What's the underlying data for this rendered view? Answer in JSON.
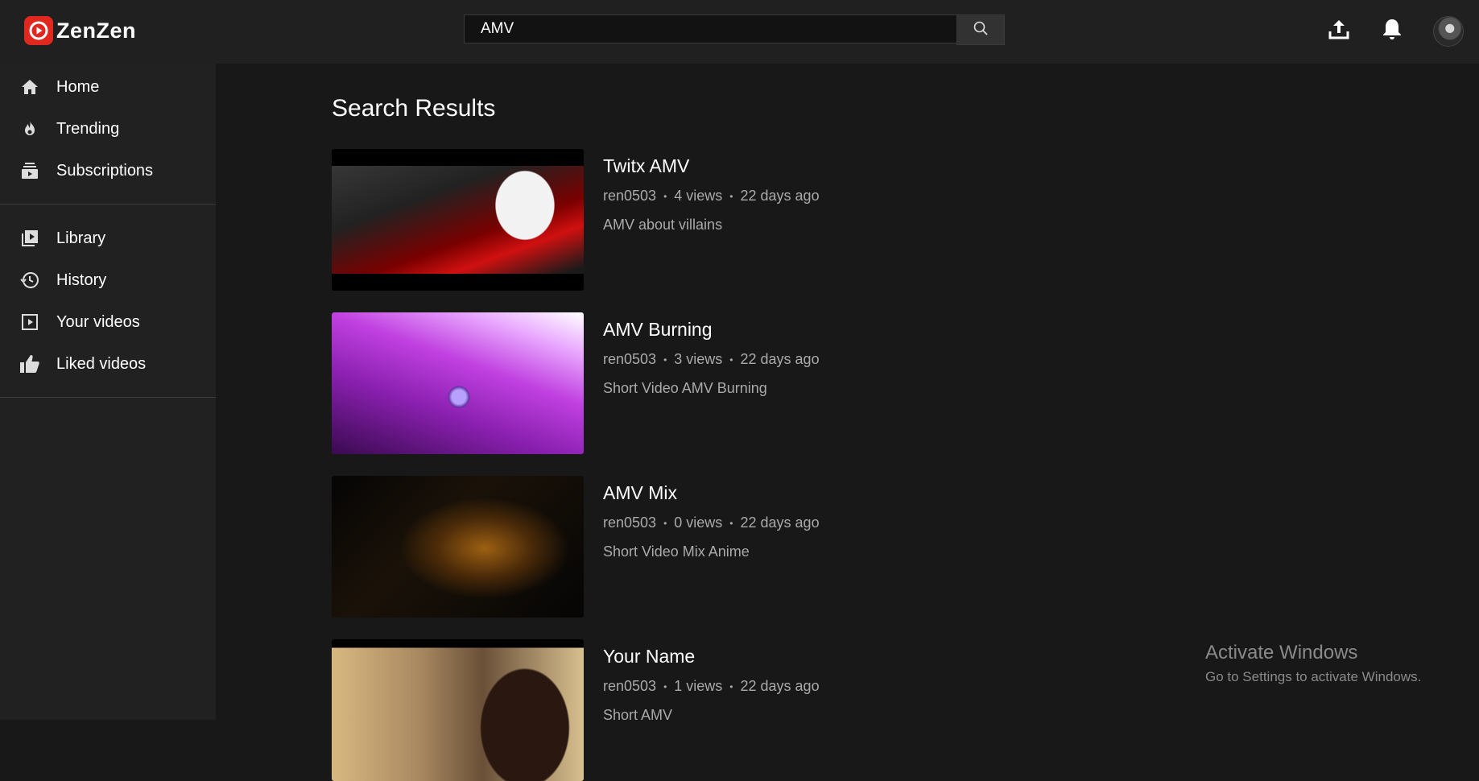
{
  "app": {
    "name": "ZenZen",
    "accent": "#e0281f"
  },
  "search": {
    "value": "AMV",
    "button_icon": "search-icon"
  },
  "header_icons": [
    "upload-icon",
    "bell-icon",
    "avatar"
  ],
  "sidebar": {
    "primary": [
      {
        "label": "Home",
        "icon": "home-icon"
      },
      {
        "label": "Trending",
        "icon": "flame-icon"
      },
      {
        "label": "Subscriptions",
        "icon": "subscriptions-icon"
      }
    ],
    "secondary": [
      {
        "label": "Library",
        "icon": "library-icon"
      },
      {
        "label": "History",
        "icon": "history-icon"
      },
      {
        "label": "Your videos",
        "icon": "your-videos-icon"
      },
      {
        "label": "Liked videos",
        "icon": "thumbs-up-icon"
      }
    ]
  },
  "main": {
    "title": "Search Results",
    "results": [
      {
        "title": "Twitx AMV",
        "channel": "ren0503",
        "views": "4 views",
        "age": "22 days ago",
        "description": "AMV about villains"
      },
      {
        "title": "AMV Burning",
        "channel": "ren0503",
        "views": "3 views",
        "age": "22 days ago",
        "description": "Short Video AMV Burning"
      },
      {
        "title": "AMV Mix",
        "channel": "ren0503",
        "views": "0 views",
        "age": "22 days ago",
        "description": "Short Video Mix Anime"
      },
      {
        "title": "Your Name",
        "channel": "ren0503",
        "views": "1 views",
        "age": "22 days ago",
        "description": "Short AMV"
      }
    ]
  },
  "watermark": {
    "line1": "Activate Windows",
    "line2": "Go to Settings to activate Windows."
  }
}
